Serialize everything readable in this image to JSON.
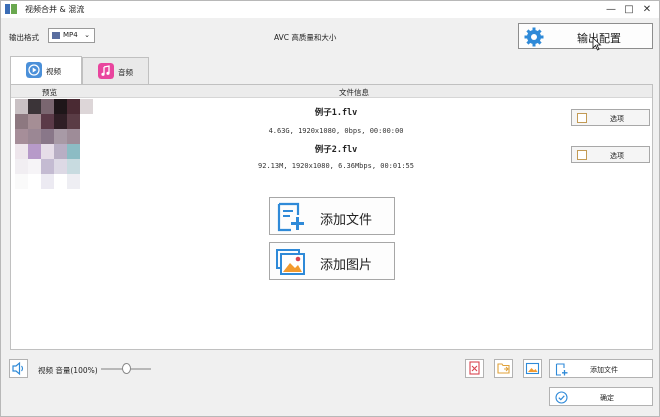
{
  "window": {
    "title": "视频合并 & 混流",
    "min": "—",
    "max": "□",
    "close": "✕"
  },
  "toolbar": {
    "format_label": "输出格式",
    "format_value": "MP4",
    "quality_text": "AVC 高质量和大小",
    "output_config_label": "输出配置"
  },
  "tabs": [
    {
      "label": "视频",
      "color": "#4b90d9"
    },
    {
      "label": "音频",
      "color": "#e9459e"
    }
  ],
  "list": {
    "col_preview": "预览",
    "col_info": "文件信息",
    "files": [
      {
        "name": "例子1.flv",
        "meta": "4.63G, 1920x1080, 0bps, 00:00:00",
        "option_label": "选项"
      },
      {
        "name": "例子2.flv",
        "meta": "92.13M, 1920x1080, 6.36Mbps, 00:01:55",
        "option_label": "选项"
      }
    ]
  },
  "actions": {
    "add_file_big": "添加文件",
    "add_image_big": "添加图片",
    "add_file": "添加文件",
    "ok": "确定"
  },
  "audio": {
    "label": "视频 音量(100%)",
    "volume_percent": 100
  },
  "colors": {
    "accent": "#2f8ad8",
    "image_icon_orange": "#f29a2e",
    "delete_red": "#d9434f"
  }
}
